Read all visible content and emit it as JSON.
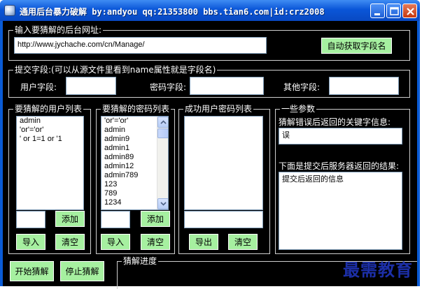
{
  "window": {
    "title": "通用后台暴力破解 by:andyou qq:21353800  bbs.tian6.com|id:crz2008"
  },
  "url_group": {
    "title": "输入要猜解的后台网址:",
    "url_value": "http://www.jychache.com/cn/Manage/",
    "auto_fetch_label": "自动获取字段名"
  },
  "fields_group": {
    "title": "提交字段:(可以从源文件里看到name属性就是字段名)",
    "user_field_label": "用户字段:",
    "pass_field_label": "密码字段:",
    "other_field_label": "其他字段:",
    "user_field_value": "",
    "pass_field_value": "",
    "other_field_value": ""
  },
  "user_list_group": {
    "title": "要猜解的用户列表",
    "items": [
      "admin",
      "'or'='or'",
      "' or 1=1 or '1"
    ],
    "add_label": "添加",
    "import_label": "导入",
    "clear_label": "清空"
  },
  "pass_list_group": {
    "title": "要猜解的密码列表",
    "items": [
      "'or'='or'",
      "admin",
      "admin9",
      "admin1",
      "admin89",
      "admin12",
      "admin789",
      "123",
      "789",
      "1234"
    ],
    "add_label": "添加",
    "import_label": "导入",
    "clear_label": "清空"
  },
  "success_group": {
    "title": "成功用户密码列表",
    "export_label": "导出",
    "clear_label": "清空"
  },
  "params_group": {
    "title": "一些参数",
    "keyword_label": "猜解错误后返回的关键字信息:",
    "keyword_value": "误",
    "result_label": "下面是提交后服务器返回的结果:",
    "result_value": "提交后返回的信息"
  },
  "footer": {
    "start_label": "开始猜解",
    "stop_label": "停止猜解",
    "progress_title": "猜解进度"
  },
  "watermark": "最需教育",
  "colors": {
    "background": "#000000",
    "button_green": "#a6f0a0",
    "titlebar_blue": "#0a56d8",
    "close_red": "#c8380e"
  }
}
